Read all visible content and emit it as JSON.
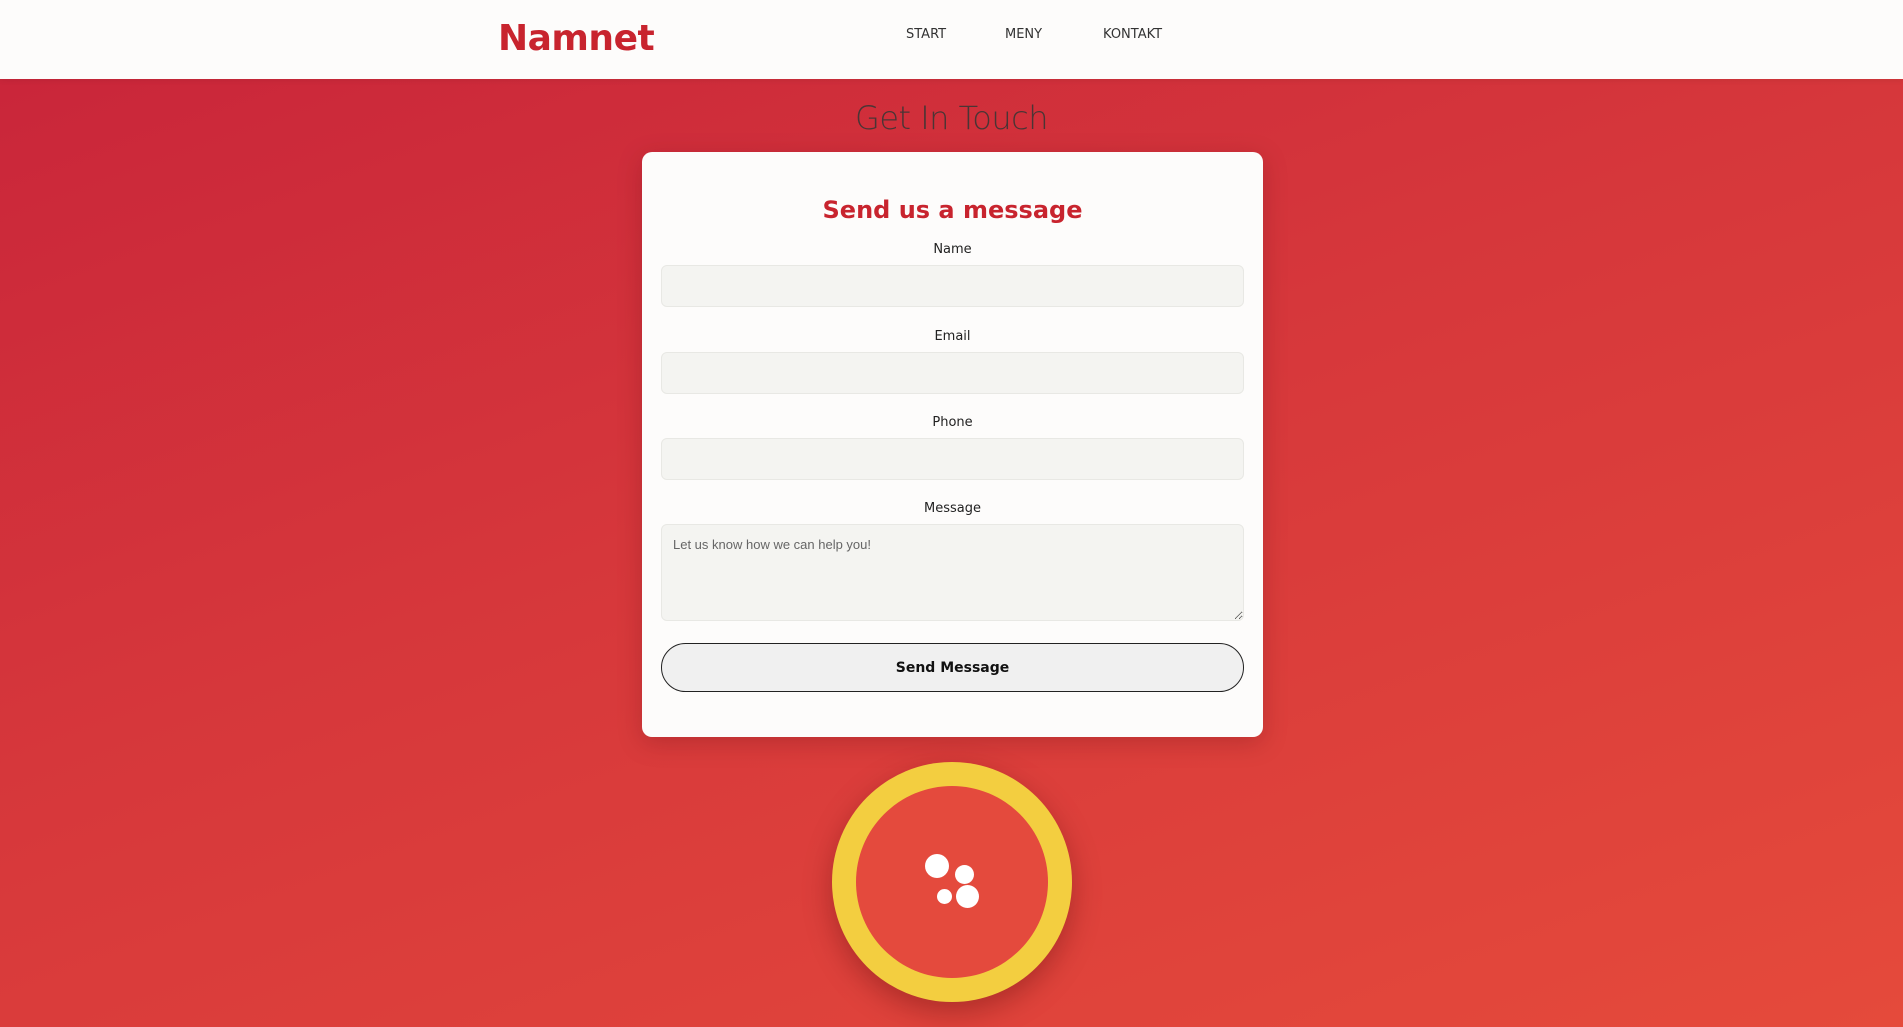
{
  "header": {
    "brand": "Namnet",
    "nav": [
      {
        "label": "START"
      },
      {
        "label": "MENY"
      },
      {
        "label": "KONTAKT"
      }
    ]
  },
  "page": {
    "heading": "Get In Touch"
  },
  "form": {
    "title": "Send us a message",
    "fields": {
      "name": {
        "label": "Name",
        "value": "",
        "placeholder": ""
      },
      "email": {
        "label": "Email",
        "value": "",
        "placeholder": ""
      },
      "phone": {
        "label": "Phone",
        "value": "",
        "placeholder": ""
      },
      "message": {
        "label": "Message",
        "value": "",
        "placeholder": "Let us know how we can help you!"
      }
    },
    "submit_label": "Send Message"
  },
  "logo": {
    "icon": "bubbles-logo-icon"
  },
  "colors": {
    "brand_red": "#c8242e",
    "background_start": "#c8243a",
    "background_end": "#e54a3b",
    "badge_yellow": "#f3ce40",
    "badge_red": "#e44a3d"
  }
}
